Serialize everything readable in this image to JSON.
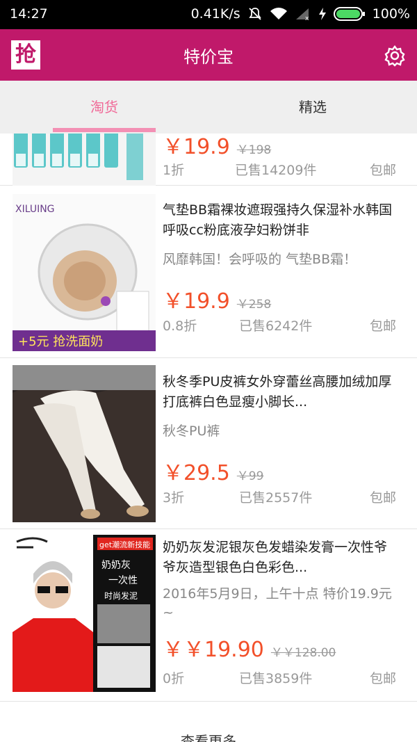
{
  "status_bar": {
    "time": "14:27",
    "net_speed": "0.41K/s",
    "battery": "100%",
    "icons": [
      "mute-icon",
      "wifi-icon",
      "signal-icon",
      "charging-icon",
      "battery-icon"
    ]
  },
  "app_bar": {
    "logo_text": "抢",
    "title": "特价宝",
    "settings_icon": "gear-icon"
  },
  "tabs": [
    {
      "label": "淘货",
      "active": true
    },
    {
      "label": "精选",
      "active": false
    }
  ],
  "colors": {
    "brand": "#c0196a",
    "active_tab": "#f06a98",
    "price": "#f2502a"
  },
  "products": [
    {
      "price": "￥19.9",
      "original_price": "￥198",
      "discount": "1折",
      "sold": "已售14209件",
      "shipping": "包邮"
    },
    {
      "title": "气垫BB霜裸妆遮瑕强持久保湿补水韩国呼吸cc粉底液孕妇粉饼非",
      "desc": "风靡韩国！会呼吸的 气垫BB霜！",
      "price": "￥19.9",
      "original_price": "￥258",
      "discount": "0.8折",
      "sold": "已售6242件",
      "shipping": "包邮",
      "image_text": {
        "brand": "XILUING",
        "promo": "+5元 抢洗面奶"
      }
    },
    {
      "title": "秋冬季PU皮裤女外穿蕾丝高腰加绒加厚打底裤白色显瘦小脚长...",
      "desc": "秋冬PU裤",
      "price": "￥29.5",
      "original_price": "￥99",
      "discount": "3折",
      "sold": "已售2557件",
      "shipping": "包邮"
    },
    {
      "title": "奶奶灰发泥银灰色发蜡染发膏一次性爷爷灰造型银色白色彩色...",
      "desc": "2016年5月9日，上午十点 特价19.9元~",
      "price": "￥￥19.90",
      "original_price": "￥￥128.00",
      "discount": "0折",
      "sold": "已售3859件",
      "shipping": "包邮",
      "image_text": {
        "badge": "get潮流新技能",
        "line1": "奶奶灰",
        "line2": "一次性",
        "line3": "时尚发泥"
      }
    }
  ],
  "load_more": "查看更多"
}
